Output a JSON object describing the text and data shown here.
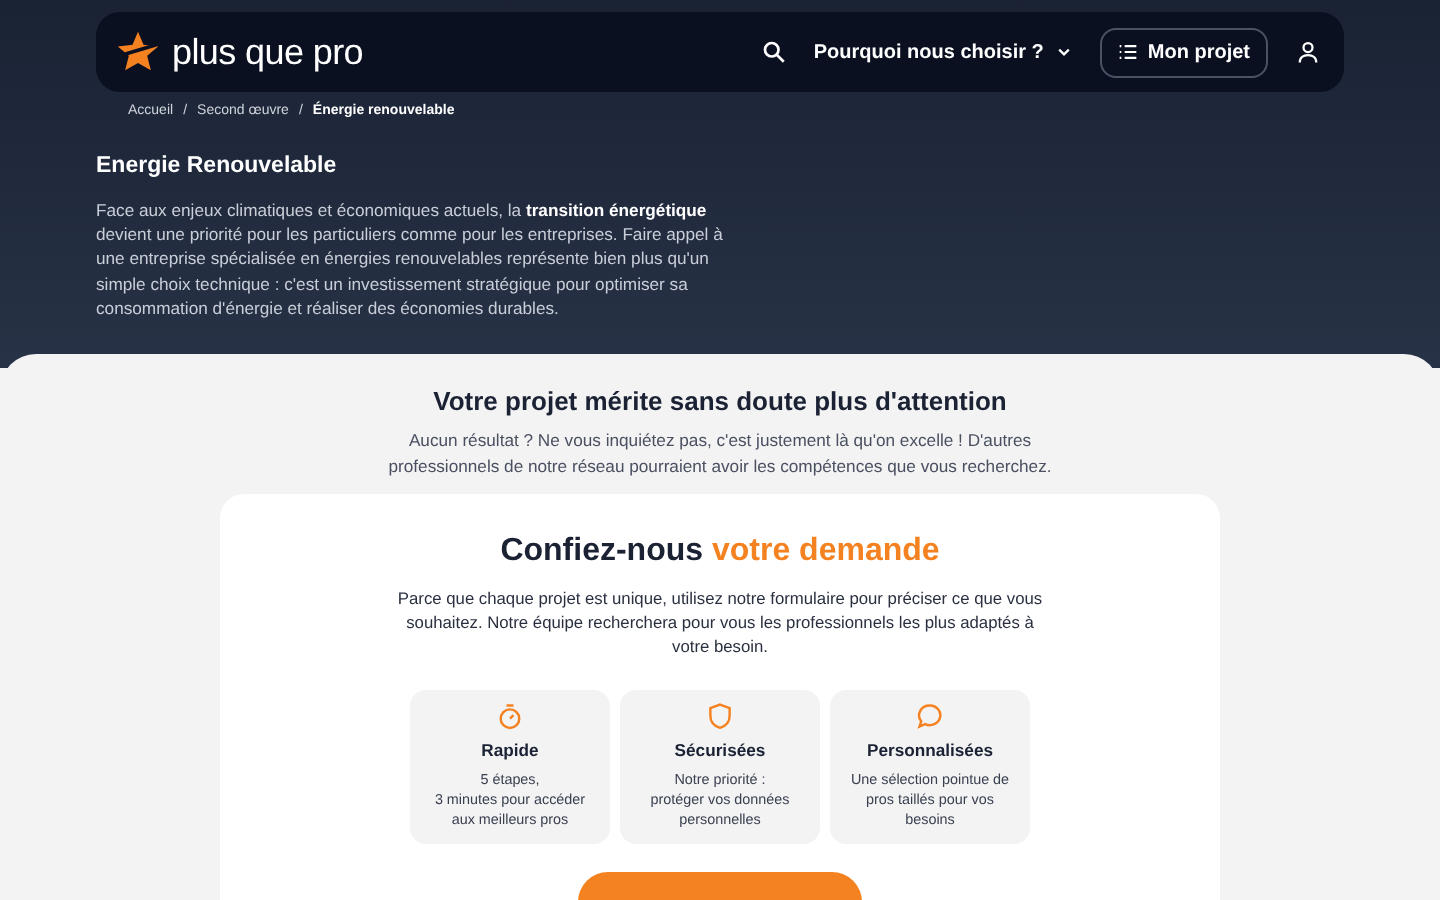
{
  "header": {
    "logo": "plus que pro",
    "nav": [
      {
        "label": "Pourquoi nous choisir ?",
        "kind": "dropdown"
      }
    ],
    "project_button": "Mon projet"
  },
  "breadcrumb": [
    {
      "label": "Accueil",
      "current": false
    },
    {
      "label": "Second œuvre",
      "current": false
    },
    {
      "label": "Énergie renouvelable",
      "current": true
    }
  ],
  "breadcrumb_separator": "/",
  "intro": {
    "title": "Energie Renouvelable",
    "text": "Face aux enjeux climatiques et économiques actuels, la **transition énergétique** devient une priorité pour les particuliers comme pour les entreprises. Faire appel à une entreprise spécialisée en énergies renouvelables représente bien plus qu'un simple choix technique : c'est un investissement stratégique pour optimiser sa consommation d'énergie et réaliser des économies durables."
  },
  "no_results": {
    "title": "Votre projet mérite sans doute plus d'attention",
    "text": "Aucun résultat ? Ne vous inquiétez pas, c'est justement là qu'on excelle ! D'autres professionnels de notre réseau pourraient avoir les compétences que vous recherchez."
  },
  "request_card": {
    "title": "Confiez-nous",
    "title_highlight": "votre demande",
    "text": "Parce que chaque projet est unique, utilisez notre formulaire pour préciser ce que vous souhaitez. Notre équipe recherchera pour vous les professionnels les plus adaptés à votre besoin.",
    "features": [
      {
        "kind": "speed",
        "title": "Rapide",
        "lines": [
          "5 étapes,",
          "3 minutes pour accéder",
          "aux meilleurs pros"
        ]
      },
      {
        "kind": "security",
        "title": "Sécurisées",
        "lines": [
          "Notre priorité :",
          "protéger vos données",
          "personnelles"
        ]
      },
      {
        "kind": "personal",
        "title": "Personnalisées",
        "lines": [
          "Une sélection pointue de",
          "pros taillés pour vos",
          "besoins"
        ]
      }
    ]
  }
}
